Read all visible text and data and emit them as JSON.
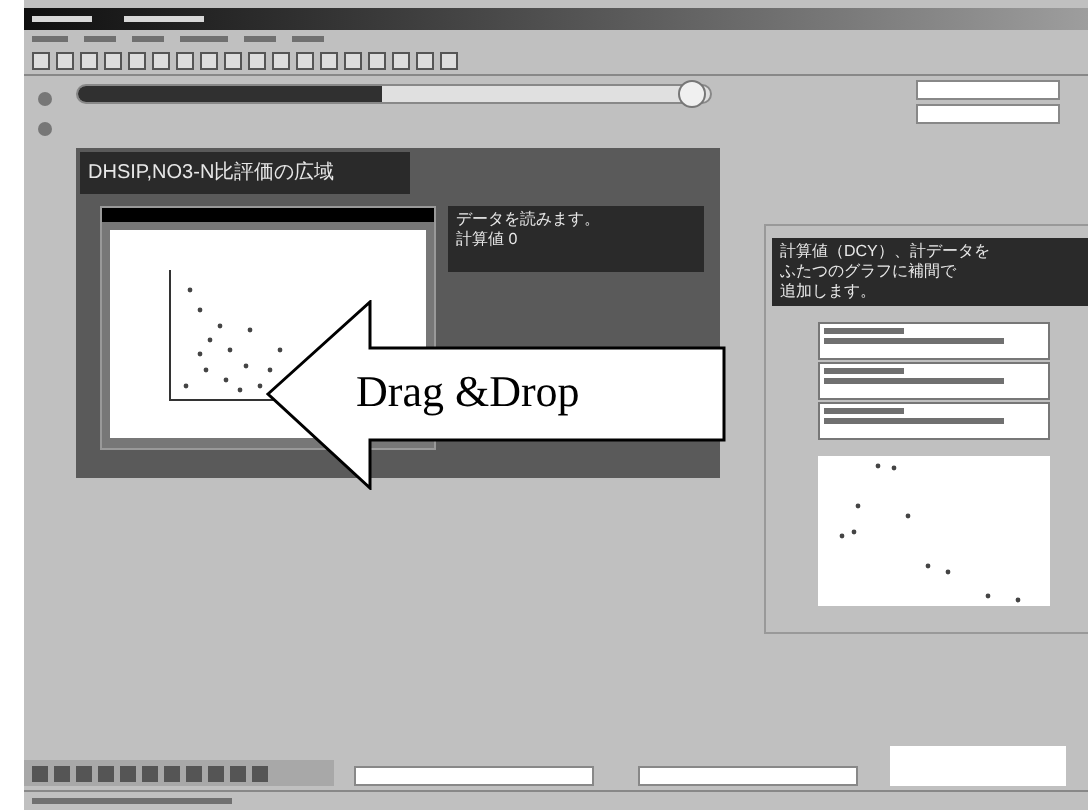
{
  "timeline": {
    "level": 0.97
  },
  "panel": {
    "heading": "DHSIP,NO3-N比評価の広域",
    "note": [
      "データを読みます。",
      "計算値 0"
    ]
  },
  "overlay": {
    "label": "Drag &Drop"
  },
  "side_panel": {
    "note": [
      "計算値（DCY）、計データを",
      "ふたつのグラフに補間で",
      "追加します。"
    ]
  }
}
